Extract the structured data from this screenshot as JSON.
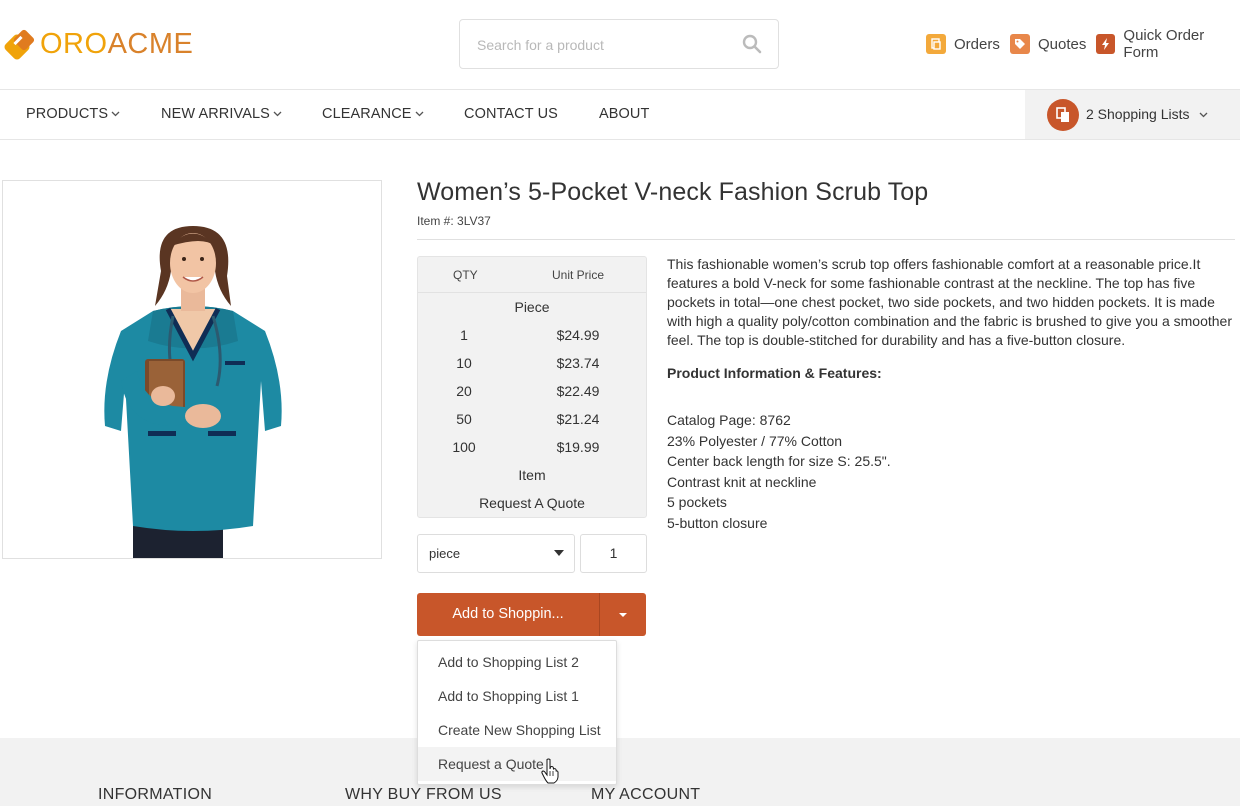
{
  "brand": {
    "logo_oro": "ORO",
    "logo_acme": "ACME"
  },
  "search": {
    "placeholder": "Search for a product",
    "value": ""
  },
  "top_links": {
    "orders": "Orders",
    "quotes": "Quotes",
    "quick_order": "Quick Order Form"
  },
  "nav": {
    "items": [
      "PRODUCTS",
      "NEW ARRIVALS",
      "CLEARANCE",
      "CONTACT US",
      "ABOUT"
    ],
    "shopping_lists": "2 Shopping Lists"
  },
  "product": {
    "title": "Women’s 5-Pocket V-neck Fashion Scrub Top",
    "item_number": "Item #: 3LV37",
    "price_table": {
      "col_qty": "QTY",
      "col_price": "Unit Price",
      "unit_piece": "Piece",
      "rows": [
        {
          "qty": "1",
          "price": "$24.99"
        },
        {
          "qty": "10",
          "price": "$23.74"
        },
        {
          "qty": "20",
          "price": "$22.49"
        },
        {
          "qty": "50",
          "price": "$21.24"
        },
        {
          "qty": "100",
          "price": "$19.99"
        }
      ],
      "unit_item": "Item",
      "request_quote": "Request A Quote"
    },
    "unit_select_value": "piece",
    "quantity_value": "1",
    "description": "This fashionable women’s scrub top offers fashionable comfort at a reasonable price.It features a bold V-neck for some fashionable contrast at the neckline. The top has five pockets in total—one chest pocket, two side pockets, and two hidden pockets. It is made with high a quality poly/cotton combination and the fabric is brushed to give you a smoother feel. The top is double-stitched for durability and has a five-button closure.",
    "features_title": "Product Information & Features:",
    "features": [
      "Catalog Page: 8762",
      "23% Polyester / 77% Cotton",
      "Center back length for size S: 25.5\".",
      "Contrast knit at neckline",
      "5 pockets",
      "5-button closure"
    ]
  },
  "add_button": {
    "label": "Add to Shoppin...",
    "menu": [
      "Add to Shopping List 2",
      "Add to Shopping List 1",
      "Create New Shopping List",
      "Request a Quote"
    ]
  },
  "footer": {
    "headings": [
      "INFORMATION",
      "WHY BUY FROM US",
      "MY ACCOUNT"
    ]
  },
  "colors": {
    "accent": "#c8562a",
    "orders_icon": "#f3a93b",
    "quotes_icon": "#e8874a",
    "quick_order_icon": "#c8562a"
  }
}
